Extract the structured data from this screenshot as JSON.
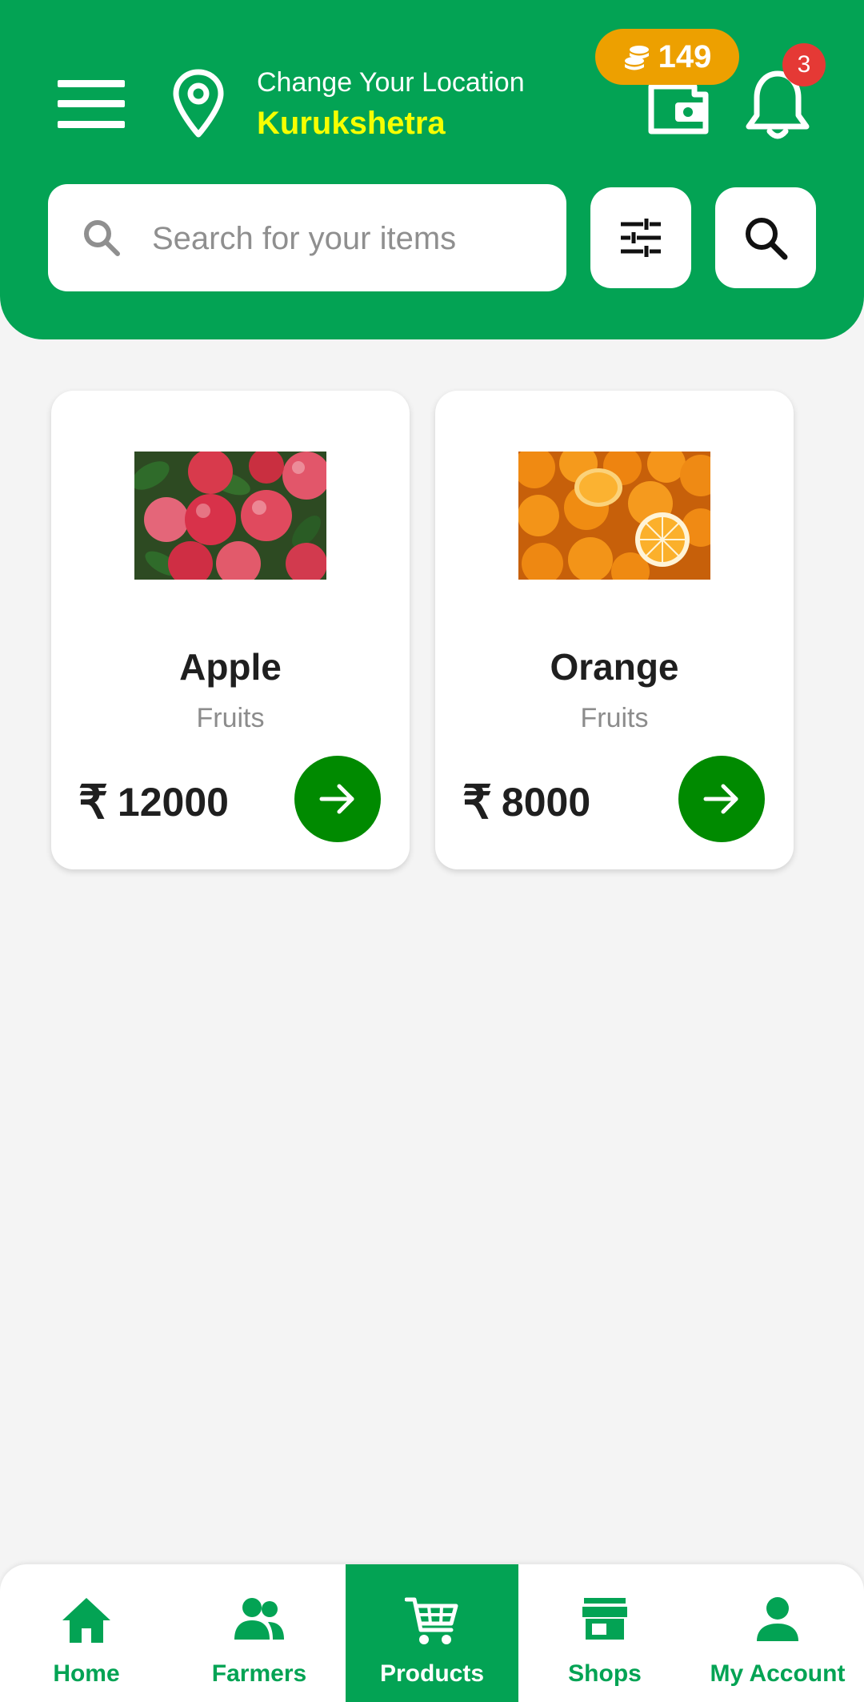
{
  "header": {
    "location_label": "Change Your Location",
    "location_city": "Kurukshetra",
    "coins": "149",
    "notification_count": "3"
  },
  "search": {
    "placeholder": "Search for your items"
  },
  "products": [
    {
      "name": "Apple",
      "category": "Fruits",
      "currency": "₹",
      "price": "12000"
    },
    {
      "name": "Orange",
      "category": "Fruits",
      "currency": "₹",
      "price": "8000"
    }
  ],
  "bottom_nav": {
    "items": [
      {
        "label": "Home",
        "icon": "home-icon"
      },
      {
        "label": "Farmers",
        "icon": "people-icon"
      },
      {
        "label": "Products",
        "icon": "cart-icon"
      },
      {
        "label": "Shops",
        "icon": "store-icon"
      },
      {
        "label": "My Account",
        "icon": "person-icon"
      }
    ],
    "active_index": 2
  },
  "colors": {
    "brand_green": "#03a354",
    "city_yellow": "#f6ff00",
    "coin_orange": "#eda000",
    "badge_red": "#e53935",
    "action_green": "#008a00",
    "background": "#f4f4f4"
  }
}
